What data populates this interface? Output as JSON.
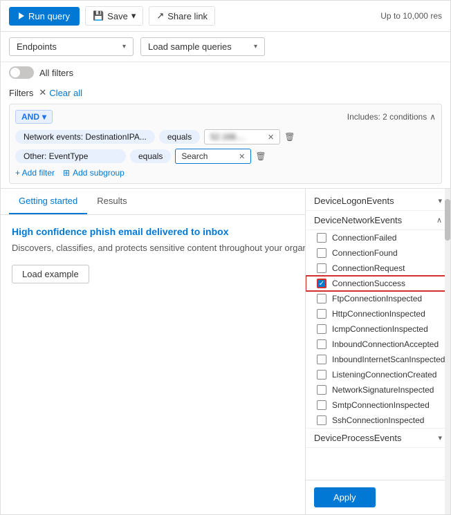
{
  "toolbar": {
    "run_query_label": "Run query",
    "save_label": "Save",
    "share_link_label": "Share link",
    "results_info": "Up to 10,000 res"
  },
  "dropdowns": {
    "endpoints_label": "Endpoints",
    "load_sample_label": "Load sample queries"
  },
  "toggle": {
    "label": "All filters"
  },
  "filters": {
    "label": "Filters",
    "clear_all": "Clear all",
    "group": {
      "operator": "AND",
      "includes_label": "Includes: 2 conditions",
      "rows": [
        {
          "field": "Network events: DestinationIPA...",
          "operator": "equals",
          "value": "52.168...."
        },
        {
          "field": "Other: EventType",
          "operator": "equals",
          "value": "Search"
        }
      ],
      "add_filter_label": "+ Add filter",
      "add_subgroup_label": "Add subgroup"
    }
  },
  "tabs": [
    {
      "label": "Getting started",
      "active": true
    },
    {
      "label": "Results",
      "active": false
    }
  ],
  "getting_started": {
    "card_title": "High confidence phish email delivered to inbox",
    "card_desc": "Discovers, classifies, and protects sensitive content throughout your organization.",
    "load_example_label": "Load example"
  },
  "dropdown_overlay": {
    "categories": [
      {
        "name": "DeviceLogonEvents",
        "expanded": false,
        "items": []
      },
      {
        "name": "DeviceNetworkEvents",
        "expanded": true,
        "items": [
          {
            "label": "ConnectionFailed",
            "checked": false,
            "highlighted": false
          },
          {
            "label": "ConnectionFound",
            "checked": false,
            "highlighted": false
          },
          {
            "label": "ConnectionRequest",
            "checked": false,
            "highlighted": false
          },
          {
            "label": "ConnectionSuccess",
            "checked": true,
            "highlighted": true
          },
          {
            "label": "FtpConnectionInspected",
            "checked": false,
            "highlighted": false
          },
          {
            "label": "HttpConnectionInspected",
            "checked": false,
            "highlighted": false
          },
          {
            "label": "IcmpConnectionInspected",
            "checked": false,
            "highlighted": false
          },
          {
            "label": "InboundConnectionAccepted",
            "checked": false,
            "highlighted": false
          },
          {
            "label": "InboundInternetScanInspected",
            "checked": false,
            "highlighted": false
          },
          {
            "label": "ListeningConnectionCreated",
            "checked": false,
            "highlighted": false
          },
          {
            "label": "NetworkSignatureInspected",
            "checked": false,
            "highlighted": false
          },
          {
            "label": "SmtpConnectionInspected",
            "checked": false,
            "highlighted": false
          },
          {
            "label": "SshConnectionInspected",
            "checked": false,
            "highlighted": false
          }
        ]
      },
      {
        "name": "DeviceProcessEvents",
        "expanded": false,
        "items": []
      }
    ],
    "apply_label": "Apply"
  }
}
